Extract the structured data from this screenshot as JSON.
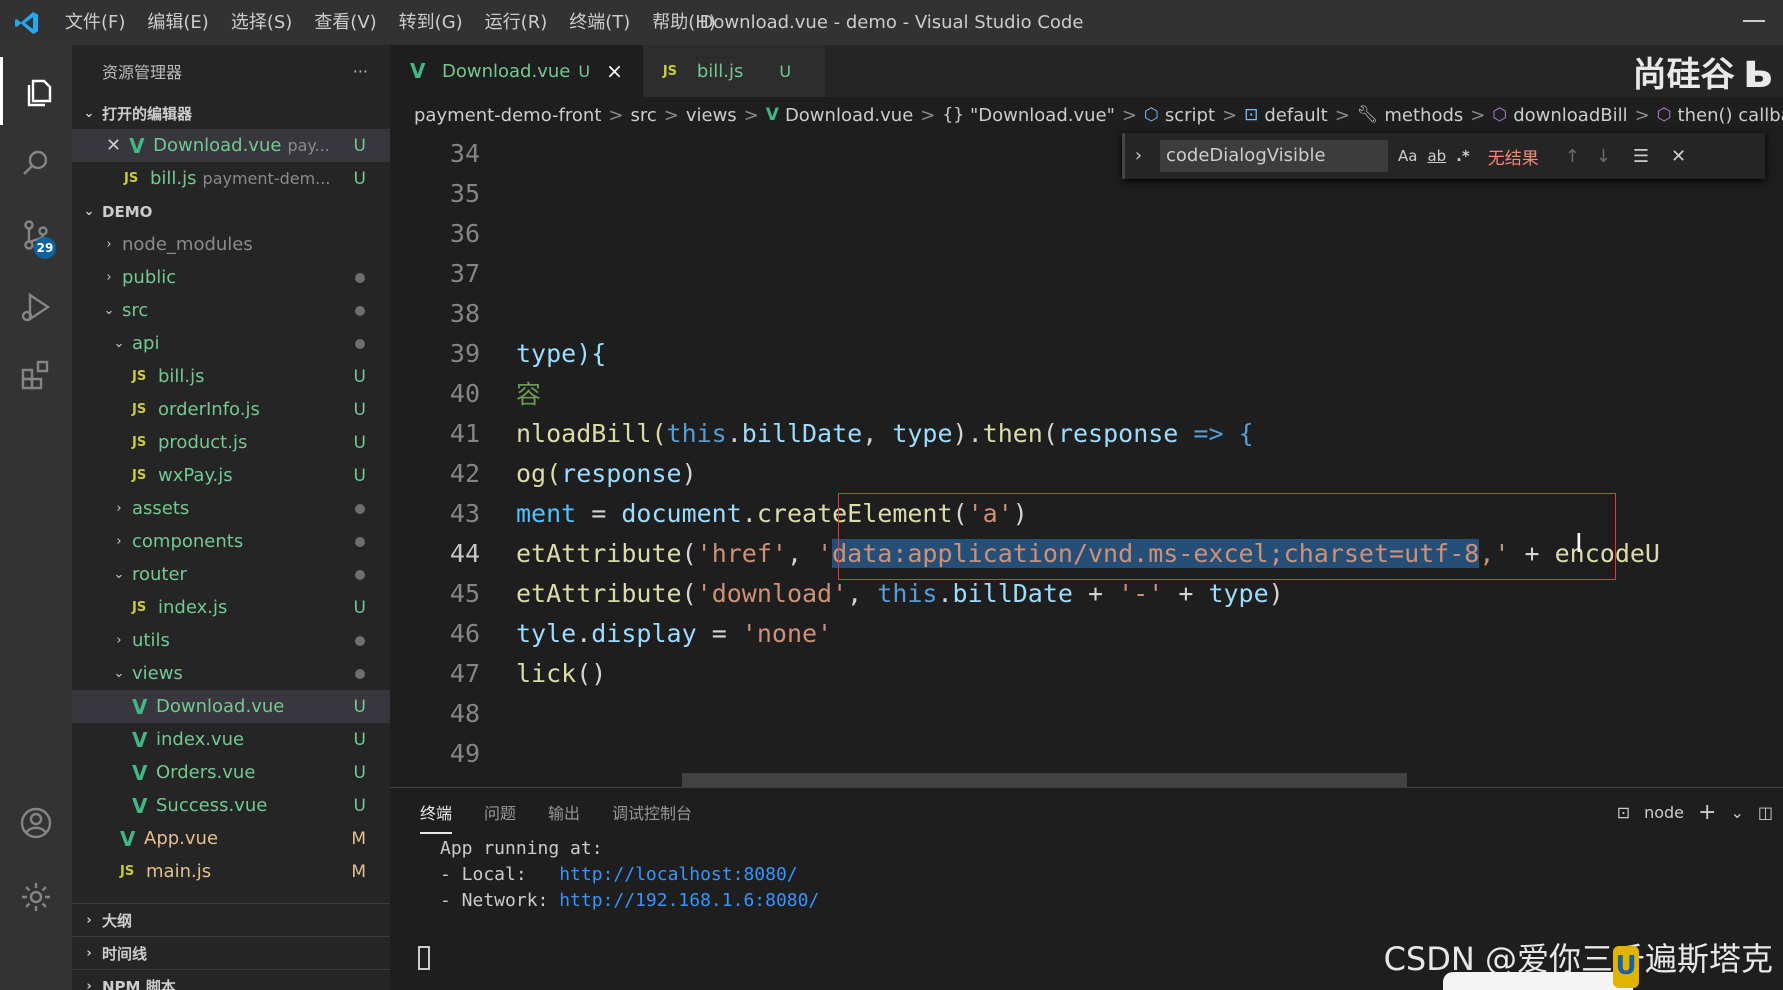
{
  "window": {
    "title": "Download.vue - demo - Visual Studio Code",
    "menu": [
      "文件(F)",
      "编辑(E)",
      "选择(S)",
      "查看(V)",
      "转到(G)",
      "运行(R)",
      "终端(T)",
      "帮助(H)"
    ]
  },
  "activity": {
    "scm_badge": "29"
  },
  "sidebar": {
    "title": "资源管理器",
    "more": "···",
    "open_editors_label": "打开的编辑器",
    "open_editors": [
      {
        "name": "Download.vue",
        "path": "pay...",
        "status": "U"
      },
      {
        "name": "bill.js",
        "path": "payment-dem...",
        "status": "U"
      }
    ],
    "project_label": "DEMO",
    "tree": [
      {
        "name": "node_modules"
      },
      {
        "name": "public"
      },
      {
        "name": "src"
      },
      {
        "name": "api"
      },
      {
        "name": "bill.js",
        "status": "U"
      },
      {
        "name": "orderInfo.js",
        "status": "U"
      },
      {
        "name": "product.js",
        "status": "U"
      },
      {
        "name": "wxPay.js",
        "status": "U"
      },
      {
        "name": "assets"
      },
      {
        "name": "components"
      },
      {
        "name": "router"
      },
      {
        "name": "index.js",
        "status": "U"
      },
      {
        "name": "utils"
      },
      {
        "name": "views"
      },
      {
        "name": "Download.vue",
        "status": "U"
      },
      {
        "name": "index.vue",
        "status": "U"
      },
      {
        "name": "Orders.vue",
        "status": "U"
      },
      {
        "name": "Success.vue",
        "status": "U"
      },
      {
        "name": "App.vue",
        "status": "M"
      },
      {
        "name": "main.js",
        "status": "M"
      }
    ],
    "outline_label": "大纲",
    "timeline_label": "时间线",
    "npm_label": "NPM 脚本"
  },
  "tabs": [
    {
      "icon": "V",
      "label": "Download.vue",
      "status": "U",
      "close": "×"
    },
    {
      "icon": "JS",
      "label": "bill.js",
      "status": "U"
    }
  ],
  "brand": "尚硅谷",
  "breadcrumb": {
    "items": [
      "payment-demo-front",
      "src",
      "views",
      "Download.vue",
      "\"Download.vue\"",
      "script",
      "default",
      "methods",
      "downloadBill",
      "then() callback"
    ],
    "sep": ">"
  },
  "find": {
    "value": "codeDialogVisible",
    "opt_case": "Aa",
    "opt_word": "ab",
    "opt_regex": ".*",
    "result": "无结果"
  },
  "editor": {
    "line_numbers": [
      "34",
      "35",
      "36",
      "37",
      "38",
      "39",
      "40",
      "41",
      "42",
      "43",
      "44",
      "45",
      "46",
      "47",
      "48",
      "49"
    ],
    "l39": {
      "a": "type){"
    },
    "l40": {
      "a": "容"
    },
    "l41": {
      "a": "nloadBill(",
      "b": "this",
      "c": ".",
      "d": "billDate",
      "e": ", ",
      "f": "type",
      "g": ").",
      "h": "then",
      "i": "(",
      "j": "response",
      "k": " => {"
    },
    "l42": {
      "a": "og(",
      "b": "response",
      "c": ")"
    },
    "l43": {
      "a": "ment",
      "b": " = ",
      "c": "document",
      "d": ".",
      "e": "createElement",
      "f": "(",
      "g": "'a'",
      "h": ")"
    },
    "l44": {
      "a": "etAttribute",
      "b": "(",
      "c": "'href'",
      "d": ", ",
      "e": "'",
      "f": "data:application/vnd.ms-excel;charset=utf-8",
      "g": ",'",
      "h": " + ",
      "i": "encodeU"
    },
    "l45": {
      "a": "etAttribute",
      "b": "(",
      "c": "'download'",
      "d": ", ",
      "e": "this",
      "f": ".",
      "g": "billDate",
      "h": " + ",
      "i": "'-'",
      "j": " + ",
      "k": "type",
      "l": ")"
    },
    "l46": {
      "a": "tyle",
      "b": ".",
      "c": "display",
      "d": " = ",
      "e": "'none'"
    },
    "l47": {
      "a": "lick",
      "b": "()"
    }
  },
  "panel": {
    "tabs": [
      "终端",
      "问题",
      "输出",
      "调试控制台"
    ],
    "shell": "node",
    "terminal": {
      "l1": "App running at:",
      "l2_label": "- Local:   ",
      "l2_link": "http://localhost:8080/",
      "l3_label": "- Network: ",
      "l3_link": "http://192.168.1.6:8080/"
    }
  },
  "watermark": "CSDN @爱你三千遍斯塔克",
  "ime_label": "U"
}
